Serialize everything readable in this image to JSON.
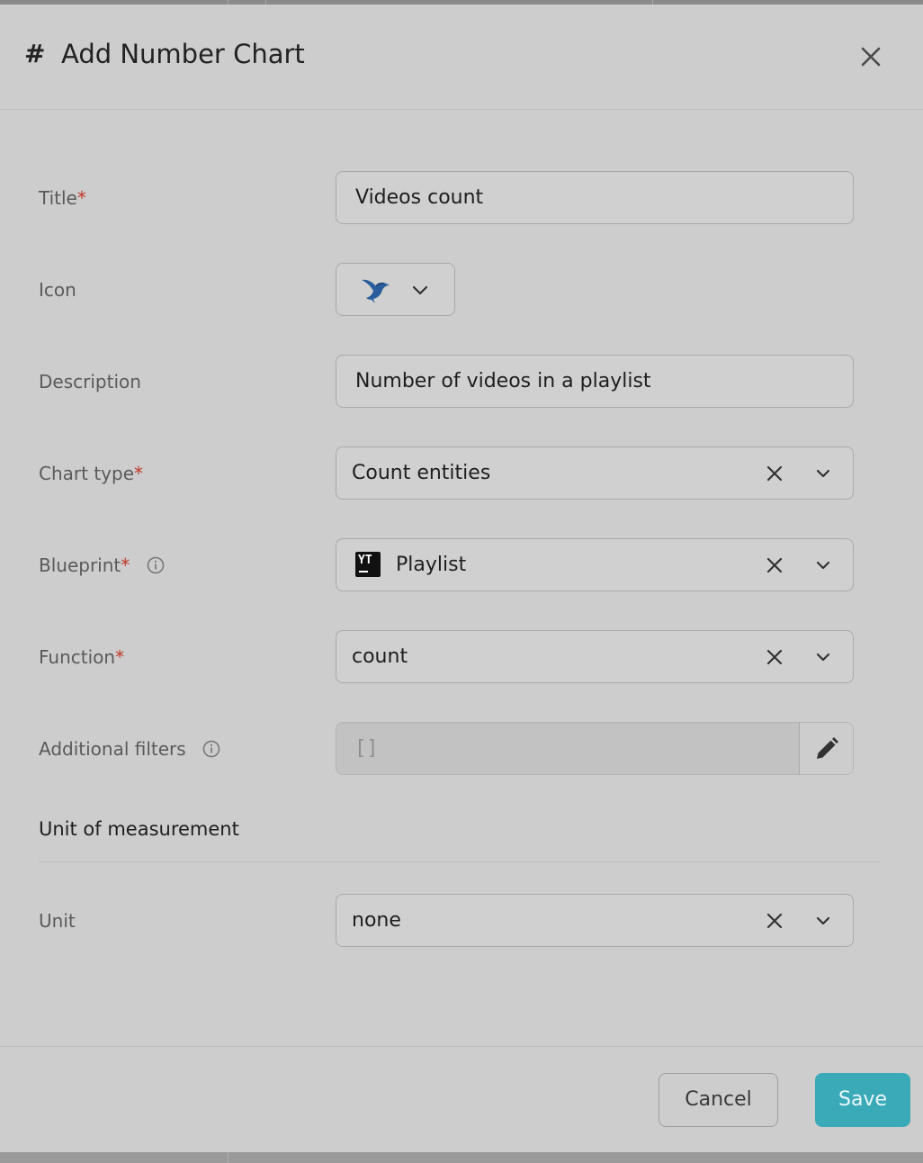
{
  "dialog": {
    "title_icon": "#",
    "title": "Add Number Chart",
    "close_icon": "close-icon"
  },
  "form": {
    "title": {
      "label": "Title",
      "required_mark": "*",
      "value": "Videos count"
    },
    "icon": {
      "label": "Icon",
      "selected_icon": "bird-icon"
    },
    "description": {
      "label": "Description",
      "value": "Number of videos in a playlist"
    },
    "chart_type": {
      "label": "Chart type",
      "required_mark": "*",
      "value": "Count entities"
    },
    "blueprint": {
      "label": "Blueprint",
      "required_mark": "*",
      "value": "Playlist",
      "badge_text": "YT"
    },
    "function": {
      "label": "Function",
      "required_mark": "*",
      "value": "count"
    },
    "additional_filters": {
      "label": "Additional filters",
      "value": "[]"
    }
  },
  "unit_section": {
    "title": "Unit of measurement",
    "unit": {
      "label": "Unit",
      "value": "none"
    }
  },
  "footer": {
    "cancel_label": "Cancel",
    "save_label": "Save"
  },
  "colors": {
    "accent": "#3aaab8",
    "required": "#c0392b",
    "modal_bg": "#cdcdcd"
  }
}
